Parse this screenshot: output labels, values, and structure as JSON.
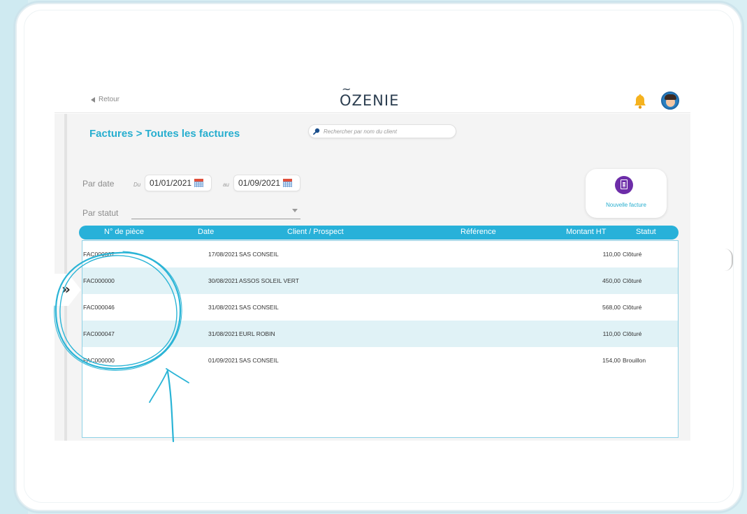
{
  "header": {
    "back_label": "Retour",
    "logo_text": "ZENIE",
    "logo_first_letter": "O"
  },
  "page": {
    "title": "Factures > Toutes les factures"
  },
  "search": {
    "placeholder": "Rechercher par nom du client"
  },
  "filters": {
    "date_label": "Par date",
    "from_label": "Du",
    "from_value": "01/01/2021",
    "to_label": "au",
    "to_value": "01/09/2021",
    "status_label": "Par statut",
    "status_value": ""
  },
  "new_invoice": {
    "label": "Nouvelle facture"
  },
  "table": {
    "headers": {
      "piece": "N° de pièce",
      "date": "Date",
      "client": "Client / Prospect",
      "reference": "Référence",
      "montant": "Montant HT",
      "statut": "Statut"
    },
    "rows": [
      {
        "piece": "FAC000007",
        "date": "17/08/2021",
        "client": "SAS CONSEIL",
        "montant": "110,00",
        "statut": "Clôturé"
      },
      {
        "piece": "FAC000000",
        "date": "30/08/2021",
        "client": "ASSOS SOLEIL VERT",
        "montant": "450,00",
        "statut": "Clôturé"
      },
      {
        "piece": "FAC000046",
        "date": "31/08/2021",
        "client": "SAS CONSEIL",
        "montant": "568,00",
        "statut": "Clôturé"
      },
      {
        "piece": "FAC000047",
        "date": "31/08/2021",
        "client": "EURL ROBIN",
        "montant": "110,00",
        "statut": "Clôturé"
      },
      {
        "piece": "FAC000000",
        "date": "01/09/2021",
        "client": "SAS CONSEIL",
        "montant": "154,00",
        "statut": "Brouillon"
      }
    ]
  },
  "colors": {
    "accent": "#27aecf",
    "header_bar": "#28b1d9",
    "new_invoice_icon": "#6d2da8",
    "bell": "#f5b21e",
    "annotation": "#2ab4d6"
  },
  "icons": {
    "back": "back-arrow-icon",
    "bell": "bell-icon",
    "search": "search-icon",
    "calendar": "calendar-icon",
    "new_invoice": "document-icon",
    "toggle": "double-chevron-right-icon"
  }
}
